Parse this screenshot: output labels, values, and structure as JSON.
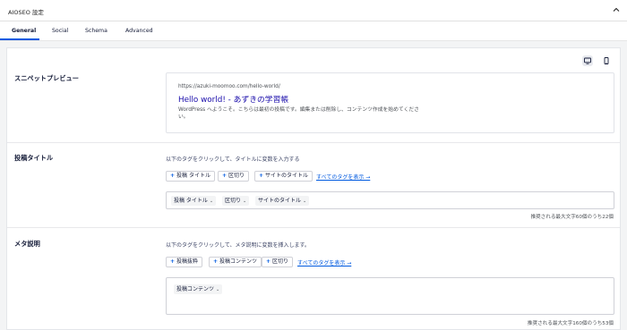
{
  "header": {
    "title": "AIOSEO 設定"
  },
  "tabs": [
    {
      "label": "General"
    },
    {
      "label": "Social"
    },
    {
      "label": "Schema"
    },
    {
      "label": "Advanced"
    }
  ],
  "snippet": {
    "label": "スニペットプレビュー",
    "url": "https://azuki-moomoo.com/hello-world/",
    "title": "Hello world! - あずきの学習帳",
    "description": "WordPress へようこそ。こちらは最初の投稿です。編集または削除し、コンテンツ作成を始めてください。"
  },
  "post_title": {
    "label": "投稿タイトル",
    "helper": "以下のタグをクリックして、タイトルに変数を入力する",
    "tags": [
      "投稿 タイトル",
      "区切り",
      "サイトのタイトル"
    ],
    "all_tags_link": "すべてのタグを表示 →",
    "chips": [
      "投稿 タイトル",
      "区切り",
      "サイトのタイトル"
    ],
    "counter": "推奨される最大文字60個のうち22個"
  },
  "meta_description": {
    "label": "メタ説明",
    "helper": "以下のタグをクリックして、メタ説明に変数を挿入します。",
    "tags": [
      "投稿抜粋",
      "投稿コンテンツ",
      "区切り"
    ],
    "all_tags_link": "すべてのタグを表示 →",
    "chips": [
      "投稿コンテンツ"
    ],
    "counter": "推奨される最大文字160個のうち53個"
  },
  "colors": {
    "accent": "#005ae0",
    "link_title": "#1a0dab"
  },
  "icons": {
    "collapse": "caret-up-icon",
    "desktop": "desktop-icon",
    "mobile": "mobile-icon",
    "chip_dropdown": "chevron-down-icon"
  }
}
